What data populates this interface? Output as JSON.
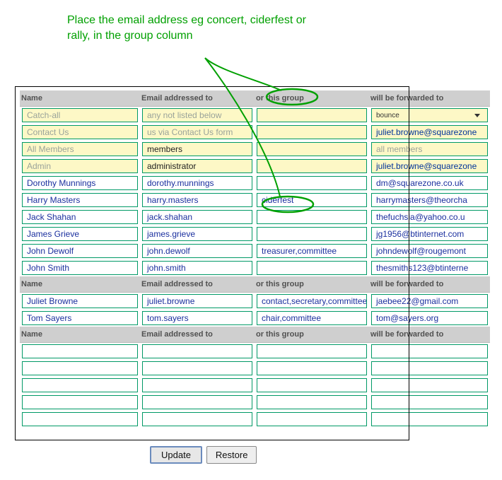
{
  "annotation": "Place the email address eg concert, ciderfest or rally, in the group column",
  "headers": {
    "name": "Name",
    "email": "Email addressed to",
    "group": "or this group",
    "forward": "will be forwarded to"
  },
  "section1": [
    {
      "name": "Catch-all",
      "email": "any not listed below",
      "group": "",
      "forward_select": "bounce",
      "special": true,
      "name_gray": true,
      "email_gray": true,
      "forward_is_select": true
    },
    {
      "name": "Contact Us",
      "email": "us via Contact Us form",
      "group": "",
      "forward": "juliet.browne@squarezone",
      "special": true,
      "name_gray": true,
      "email_gray": true
    },
    {
      "name": "All Members",
      "email": "members",
      "group": "",
      "forward": "all members",
      "special": true,
      "name_gray": true,
      "email_black": true,
      "forward_gray": true
    },
    {
      "name": "Admin",
      "email": "administrator",
      "group": "",
      "forward": "juliet.browne@squarezone",
      "special": true,
      "name_gray": true,
      "email_black": true
    },
    {
      "name": "Dorothy Munnings",
      "email": "dorothy.munnings",
      "group": "",
      "forward": "dm@squarezone.co.uk"
    },
    {
      "name": "Harry Masters",
      "email": "harry.masters",
      "group": "ciderfest",
      "forward": "harrymasters@theorcha"
    },
    {
      "name": "Jack Shahan",
      "email": "jack.shahan",
      "group": "",
      "forward": "thefuchsia@yahoo.co.u"
    },
    {
      "name": "James Grieve",
      "email": "james.grieve",
      "group": "",
      "forward": "jg1956@btinternet.com"
    },
    {
      "name": "John Dewolf",
      "email": "john.dewolf",
      "group": "treasurer,committee",
      "forward": "johndewolf@rougemont"
    },
    {
      "name": "John Smith",
      "email": "john.smith",
      "group": "",
      "forward": "thesmiths123@btinterne"
    }
  ],
  "section2": [
    {
      "name": "Juliet Browne",
      "email": "juliet.browne",
      "group": "contact,secretary,committee",
      "forward": "jaebee22@gmail.com"
    },
    {
      "name": "Tom Sayers",
      "email": "tom.sayers",
      "group": "chair,committee",
      "forward": "tom@sayers.org"
    }
  ],
  "section3_blank_rows": 5,
  "buttons": {
    "update": "Update",
    "restore": "Restore"
  }
}
